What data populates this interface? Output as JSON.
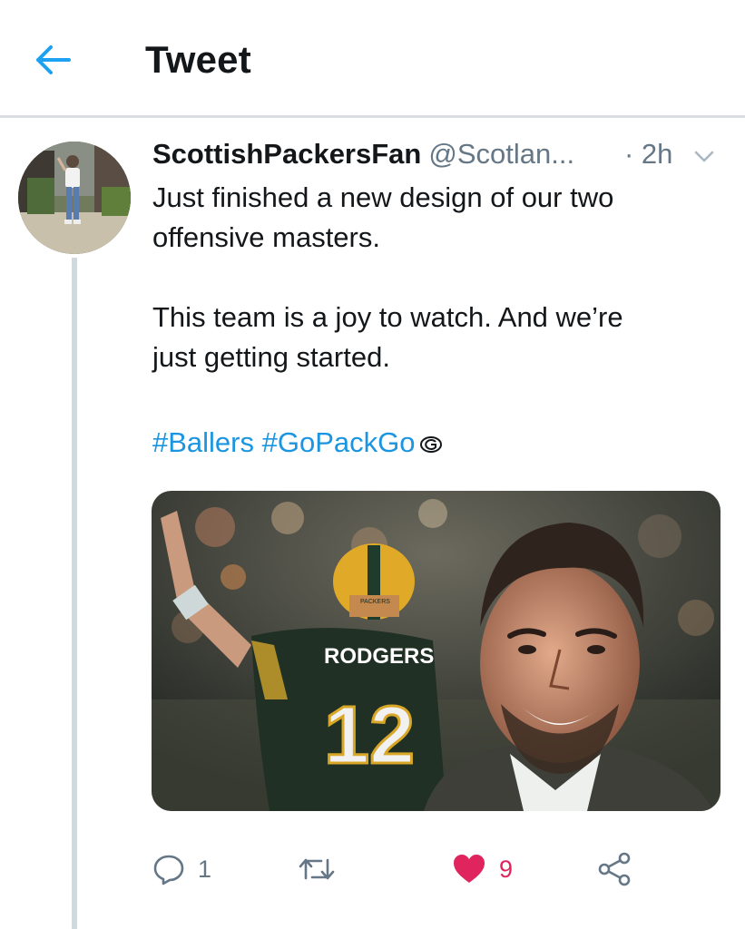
{
  "header": {
    "title": "Tweet",
    "back_icon": "back-arrow-icon",
    "accent_color": "#1da1f2"
  },
  "tweet": {
    "display_name": "ScottishPackersFan",
    "handle": "@Scotlan...",
    "time": "· 2h",
    "text_lines": [
      "Just finished a new design of our two",
      "offensive masters.",
      "This team is a joy to watch. And we’re",
      "just getting started."
    ],
    "hashtags": [
      "#Ballers",
      "#GoPackGo"
    ],
    "hashtag_color": "#1b95e0",
    "media": {
      "jersey_name": "RODGERS",
      "jersey_number": "12",
      "helmet_text": "PACKERS"
    },
    "actions": {
      "reply_count": "1",
      "retweet_count": "",
      "like_count": "9",
      "liked": true,
      "like_color": "#e0245e"
    }
  }
}
